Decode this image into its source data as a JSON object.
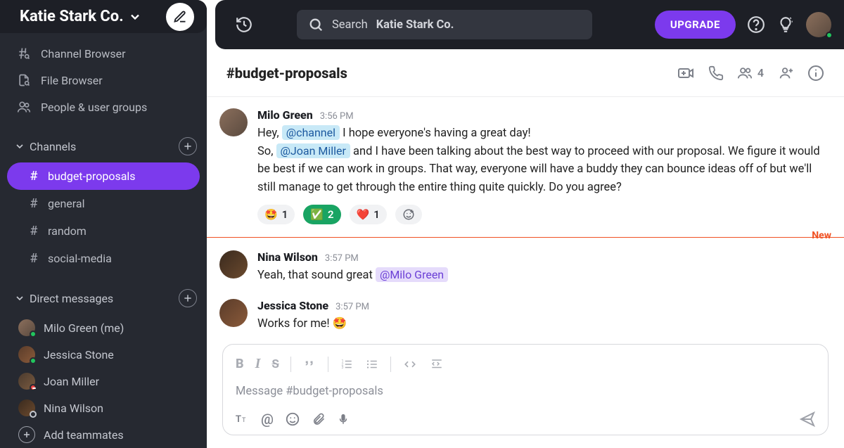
{
  "workspace": {
    "name": "Katie Stark Co."
  },
  "search": {
    "label": "Search",
    "scope": "Katie Stark Co."
  },
  "upgrade_label": "UPGRADE",
  "sidebar": {
    "links": {
      "channel_browser": "Channel Browser",
      "file_browser": "File Browser",
      "people": "People & user groups"
    },
    "channels_header": "Channels",
    "dm_header": "Direct messages",
    "channels": [
      {
        "name": "budget-proposals",
        "active": true
      },
      {
        "name": "general"
      },
      {
        "name": "random"
      },
      {
        "name": "social-media"
      }
    ],
    "dms": [
      {
        "name": "Milo Green (me)",
        "status": "online"
      },
      {
        "name": "Jessica Stone",
        "status": "online"
      },
      {
        "name": "Joan Miller",
        "status": "busy"
      },
      {
        "name": "Nina Wilson",
        "status": "away"
      }
    ],
    "add_teammates": "Add teammates"
  },
  "channel_header": {
    "title": "#budget-proposals",
    "member_count": "4"
  },
  "messages": [
    {
      "author": "Milo Green",
      "time": "3:56 PM",
      "segments": [
        {
          "t": "Hey, "
        },
        {
          "mention": "@channel",
          "style": "blue"
        },
        {
          "t": "  I hope everyone's having a great day!"
        },
        {
          "br": true
        },
        {
          "t": "So, "
        },
        {
          "mention": "@Joan Miller",
          "style": "blue"
        },
        {
          "t": "  and I have been talking about the best way to proceed with our proposal. We figure it would be best if we can work in groups. That way, everyone will have a buddy they can bounce ideas off of but  we'll still manage to get through the entire thing quite quickly. Do you agree?"
        }
      ],
      "reactions": [
        {
          "emoji": "🤩",
          "count": "1"
        },
        {
          "emoji": "✅",
          "count": "2",
          "mine": true
        },
        {
          "emoji": "❤️",
          "count": "1"
        }
      ]
    },
    {
      "author": "Nina Wilson",
      "time": "3:57 PM",
      "segments": [
        {
          "t": "Yeah, that sound great "
        },
        {
          "mention": "@Milo Green",
          "style": "purple"
        }
      ]
    },
    {
      "author": "Jessica Stone",
      "time": "3:57 PM",
      "segments": [
        {
          "t": "Works for me! 🤩"
        }
      ]
    }
  ],
  "divider": {
    "label": "New"
  },
  "composer": {
    "placeholder": "Message #budget-proposals"
  }
}
